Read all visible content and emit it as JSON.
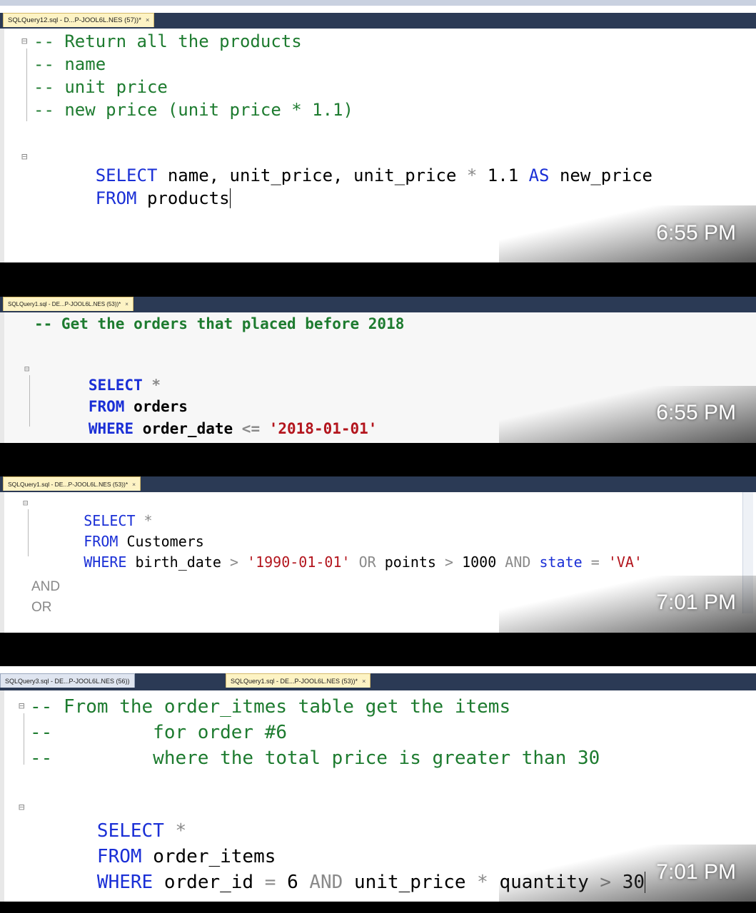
{
  "panel1": {
    "tab": "SQLQuery12.sql - D...P-JOOL6L.NES (57))*",
    "tab_close": "× ",
    "lines": [
      "-- Return all the products",
      "-- name",
      "-- unit price",
      "-- new price (unit price * 1.1)"
    ],
    "select_kw": "SELECT",
    "select_rest": " name, unit_price, unit_price",
    "op_star": " * ",
    "select_num": "1.1",
    "as_kw": " AS",
    "alias": " new_price",
    "from_kw": "FROM",
    "from_rest": " products",
    "timestamp": "6:55 PM"
  },
  "panel2": {
    "tab": "SQLQuery1.sql - DE...P-JOOL6L.NES (53))*",
    "tab_close": "× ",
    "comment": "-- Get the orders that placed before 2018",
    "select_kw": "SELECT",
    "select_rest": " *",
    "from_kw": "FROM",
    "from_rest": " orders",
    "where_kw": "WHERE",
    "where_col": " order_date",
    "op": " <= ",
    "value": "'2018-01-01'",
    "timestamp": "6:55 PM"
  },
  "panel3": {
    "tab": "SQLQuery1.sql - DE...P-JOOL6L.NES (53))*",
    "tab_close": "× ",
    "select_kw": "SELECT",
    "select_rest": " *",
    "from_kw": "FROM",
    "from_rest": " Customers",
    "where_kw": "WHERE",
    "where_col": " birth_date",
    "op1": " > ",
    "value1": "'1990-01-01'",
    "or_kw": " OR",
    "col2": " points",
    "op2": " > ",
    "value2": "1000",
    "and_kw": " AND",
    "col3": " state",
    "op3": " = ",
    "value3": "'VA'",
    "note1": "AND",
    "note2": "OR",
    "timestamp": "7:01 PM"
  },
  "panel4": {
    "tab_inactive": "SQLQuery3.sql - DE...P-JOOL6L.NES (56))",
    "tab_active": "SQLQuery1.sql - DE...P-JOOL6L.NES (53))*",
    "tab_close": "× ",
    "lines": [
      "-- From the order_itmes table get the items",
      "--         for order #6",
      "--         where the total price is greater than 30"
    ],
    "select_kw": "SELECT",
    "select_rest": " *",
    "from_kw": "FROM",
    "from_rest": " order_items",
    "where_kw": "WHERE",
    "where_col": " order_id",
    "op1": " = ",
    "value1": "6",
    "and_kw": " AND",
    "col2": " unit_price",
    "op2": " * ",
    "col3": "quantity",
    "op3": " > ",
    "value3": "30",
    "timestamp": "7:01 PM"
  }
}
